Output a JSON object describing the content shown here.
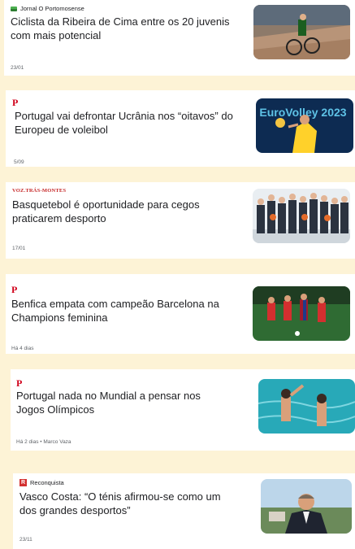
{
  "articles": [
    {
      "source": "Jornal O Portomosense",
      "source_logo": "green-flag-icon",
      "title": "Ciclista da Ribeira de Cima entre os 20 juvenis com mais potencial",
      "meta": "23/01",
      "thumb": "cyclist-velodrome-image"
    },
    {
      "source": "P",
      "source_logo": "publico-p-logo",
      "title": "Portugal vai defrontar Ucrânia nos “oitavos” do Europeu de voleibol",
      "meta": "5/09",
      "thumb_text": "EuroVolley 2023",
      "thumb": "volleyball-player-image"
    },
    {
      "source": "VOZ.TRÁS-MONTES",
      "source_logo": "voz-tras-montes-logo",
      "title": "Basquetebol é oportunidade para cegos praticarem desporto",
      "meta": "17/01",
      "thumb": "group-photo-image"
    },
    {
      "source": "P",
      "source_logo": "publico-p-logo",
      "title": "Benfica empata com campeão Barcelona na Champions feminina",
      "meta": "Há 4 dias",
      "thumb": "football-match-image"
    },
    {
      "source": "P",
      "source_logo": "publico-p-logo",
      "title": "Portugal nada no Mundial a pensar nos Jogos Olímpicos",
      "meta": "Há 2 dias • Marco Vaza",
      "thumb": "synchronized-swimming-image"
    },
    {
      "source": "Reconquista",
      "source_logo": "reconquista-logo",
      "title": "Vasco Costa: “O ténis afirmou-se como um dos grandes desportos”",
      "meta": "23/11",
      "thumb": "man-portrait-image"
    }
  ],
  "colors": {
    "page_bg": "#fdf3d6",
    "card_bg": "#ffffff",
    "publico_red": "#d0021b"
  }
}
